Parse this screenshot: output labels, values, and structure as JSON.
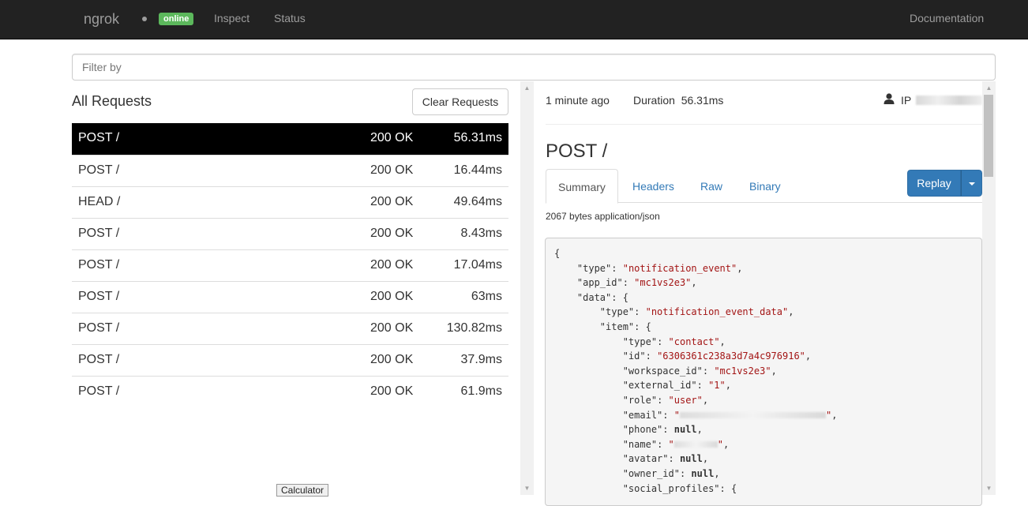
{
  "navbar": {
    "brand": "ngrok",
    "badge": "online",
    "links": [
      "Inspect",
      "Status"
    ],
    "docs": "Documentation"
  },
  "filter": {
    "placeholder": "Filter by"
  },
  "left": {
    "title": "All Requests",
    "clear_label": "Clear Requests",
    "requests": [
      {
        "method": "POST /",
        "status": "200 OK",
        "duration": "56.31ms"
      },
      {
        "method": "POST /",
        "status": "200 OK",
        "duration": "16.44ms"
      },
      {
        "method": "HEAD /",
        "status": "200 OK",
        "duration": "49.64ms"
      },
      {
        "method": "POST /",
        "status": "200 OK",
        "duration": "8.43ms"
      },
      {
        "method": "POST /",
        "status": "200 OK",
        "duration": "17.04ms"
      },
      {
        "method": "POST /",
        "status": "200 OK",
        "duration": "63ms"
      },
      {
        "method": "POST /",
        "status": "200 OK",
        "duration": "130.82ms"
      },
      {
        "method": "POST /",
        "status": "200 OK",
        "duration": "37.9ms"
      },
      {
        "method": "POST /",
        "status": "200 OK",
        "duration": "61.9ms"
      }
    ]
  },
  "detail": {
    "time_ago": "1 minute ago",
    "duration_label": "Duration",
    "duration": "56.31ms",
    "ip_label": "IP",
    "title": "POST /",
    "tabs": [
      "Summary",
      "Headers",
      "Raw",
      "Binary"
    ],
    "replay_label": "Replay",
    "body_info": "2067 bytes application/json",
    "json": {
      "l0": "{",
      "type_key": "\"type\"",
      "type_val": "\"notification_event\"",
      "app_key": "\"app_id\"",
      "app_val": "\"mc1vs2e3\"",
      "data_key": "\"data\"",
      "dtype_key": "\"type\"",
      "dtype_val": "\"notification_event_data\"",
      "item_key": "\"item\"",
      "itype_key": "\"type\"",
      "itype_val": "\"contact\"",
      "id_key": "\"id\"",
      "id_val": "\"6306361c238a3d7a4c976916\"",
      "ws_key": "\"workspace_id\"",
      "ws_val": "\"mc1vs2e3\"",
      "ext_key": "\"external_id\"",
      "ext_val": "\"1\"",
      "role_key": "\"role\"",
      "role_val": "\"user\"",
      "email_key": "\"email\"",
      "phone_key": "\"phone\"",
      "name_key": "\"name\"",
      "avatar_key": "\"avatar\"",
      "owner_key": "\"owner_id\"",
      "social_key": "\"social_profiles\"",
      "null": "null"
    }
  },
  "taskbar_tooltip": "Calculator",
  "colors": {
    "navbar": "#222222",
    "online": "#5cb85c",
    "link": "#337ab7",
    "selected_row": "#000000",
    "json_string": "#a31515"
  }
}
